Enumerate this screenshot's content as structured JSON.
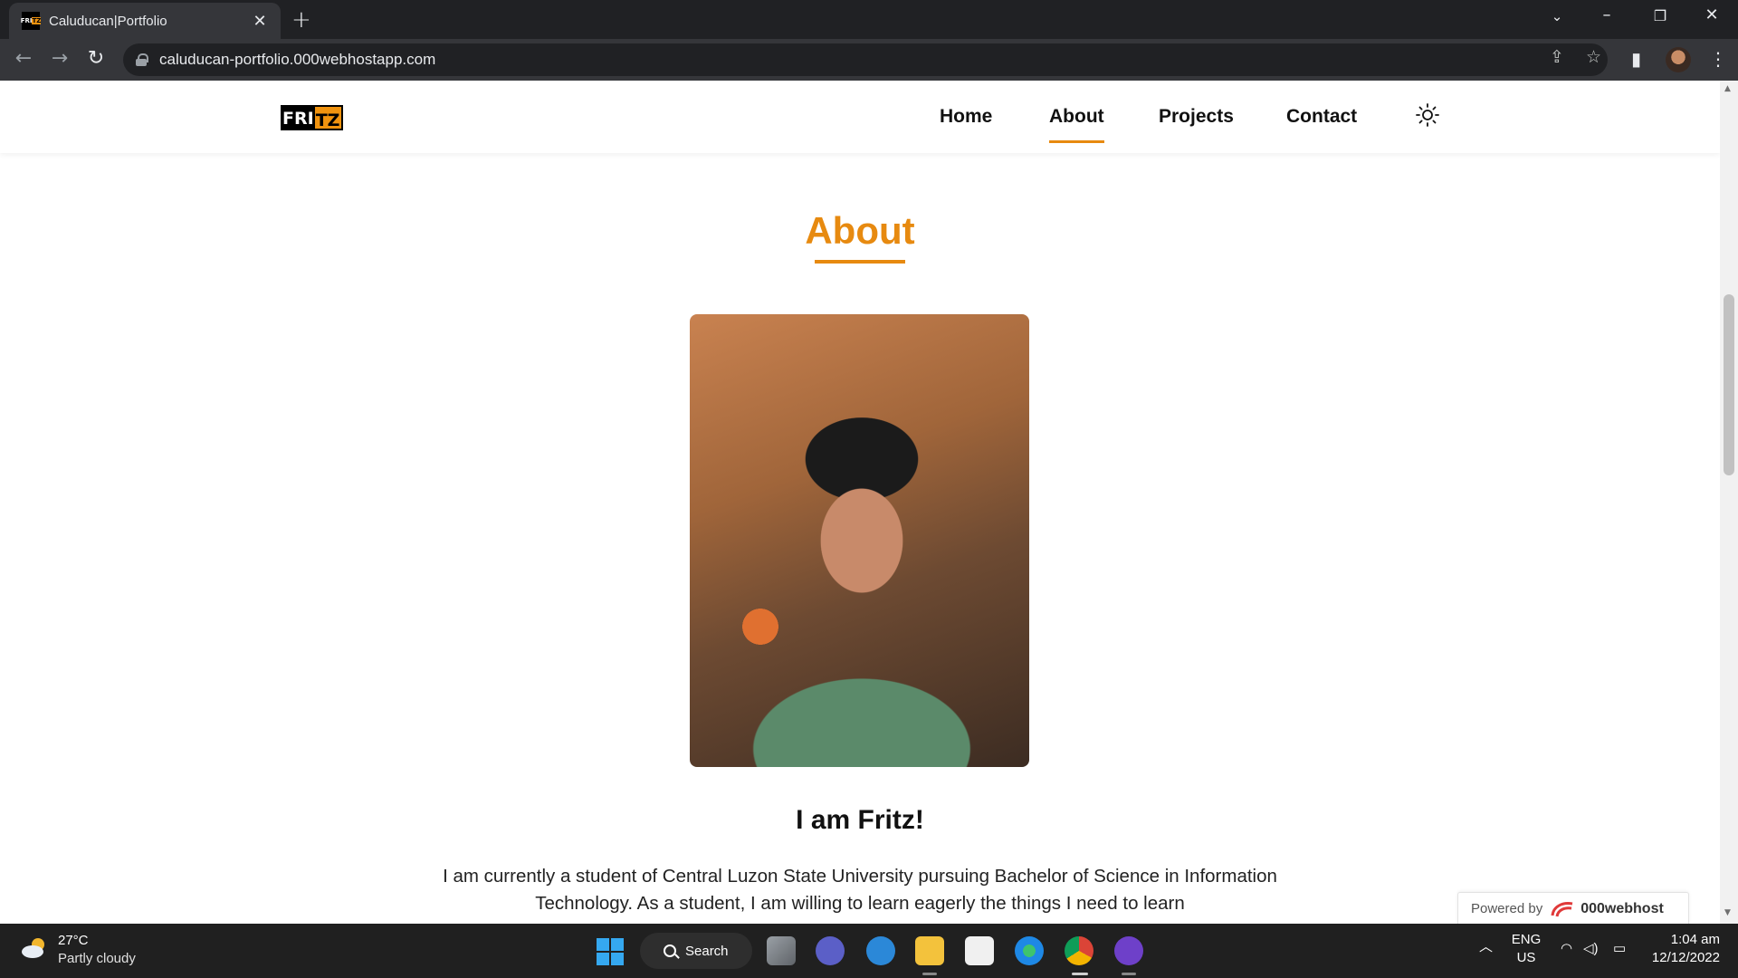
{
  "browser": {
    "tab_title": "Caluducan|Portfolio",
    "favicon_text_a": "FRI",
    "favicon_text_b": "TZ",
    "url": "caluducan-portfolio.000webhostapp.com"
  },
  "site": {
    "logo_a": "FRI",
    "logo_b": "TZ",
    "nav": [
      "Home",
      "About",
      "Projects",
      "Contact"
    ],
    "active_nav": "About",
    "accent_color": "#e78a10"
  },
  "about": {
    "title": "About",
    "heading": "I am Fritz!",
    "paragraph": "I am currently a student of Central Luzon State University pursuing Bachelor of Science in Information Technology. As a student, I am willing to learn eagerly the things I need to learn"
  },
  "powered": {
    "label": "Powered by",
    "brand": "000webhost"
  },
  "taskbar": {
    "weather_temp": "27°C",
    "weather_desc": "Partly cloudy",
    "search_label": "Search",
    "lang_line1": "ENG",
    "lang_line2": "US",
    "time": "1:04 am",
    "date": "12/12/2022"
  }
}
